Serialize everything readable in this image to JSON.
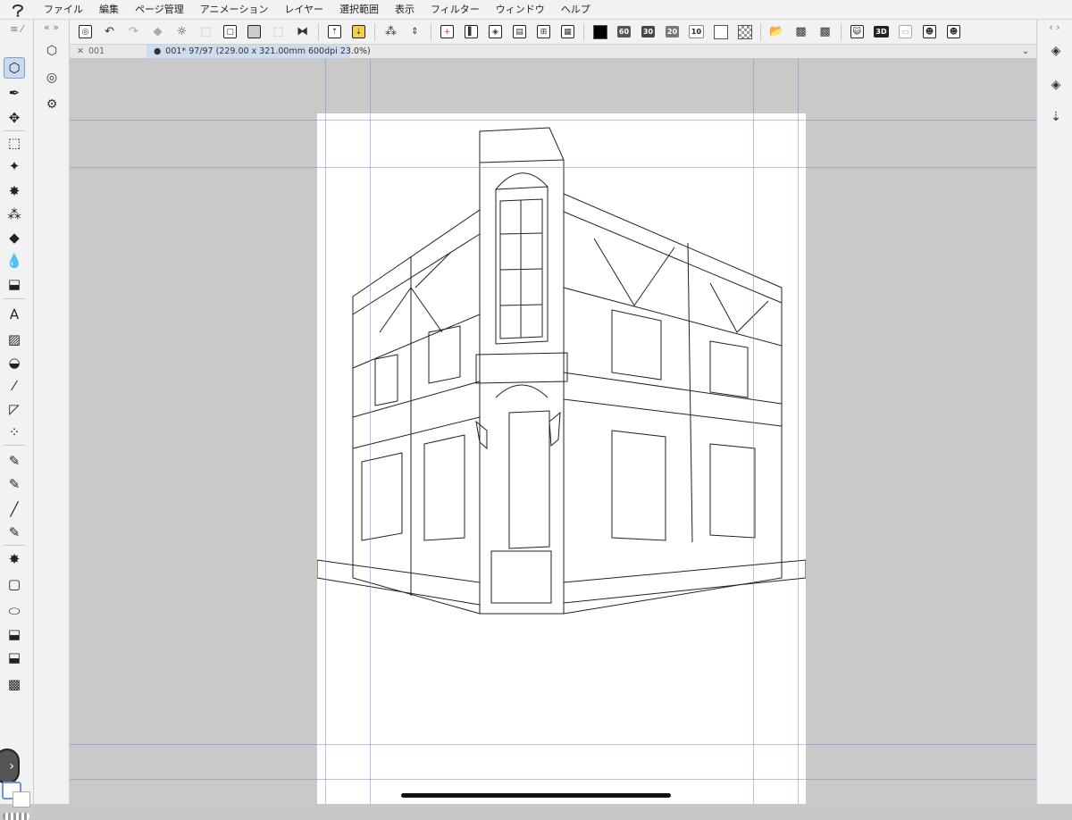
{
  "menu": {
    "items": [
      "ファイル",
      "編集",
      "ページ管理",
      "アニメーション",
      "レイヤー",
      "選択範囲",
      "表示",
      "フィルター",
      "ウィンドウ",
      "ヘルプ"
    ]
  },
  "command_bar": {
    "icons": [
      "clip-studio-icon",
      "undo-icon",
      "redo-icon",
      "erase-icon",
      "deselect-icon",
      "invert-selection-icon",
      "crop-icon",
      "fill-selection-icon",
      "clear-selection-icon",
      "transform-icon",
      "flip-horizontal-icon",
      "export-icon",
      "import-icon",
      "snap-icon",
      "stepper-icon",
      "new-layer-icon",
      "raster-layer-icon",
      "vector-layer-icon",
      "folder-layer-icon",
      "merge-layer-icon",
      "layer-mask-icon"
    ],
    "color_badges": [
      "60",
      "30",
      "20",
      "10"
    ],
    "colors": {
      "black": "#000000",
      "white": "#ffffff"
    }
  },
  "tabs": {
    "closed_tab": "001",
    "active_tab": "001* 97/97 (229.00 x 321.00mm 600dpi 23.0%)"
  },
  "toolbar": {
    "tools": [
      "operation-icon",
      "pen-icon",
      "move-icon",
      "selection-icon",
      "magic-wand-icon",
      "sparkle-icon",
      "pattern-icon",
      "eraser-icon",
      "blend-icon",
      "stamp-icon",
      "text-icon",
      "gradient-icon",
      "fill-icon",
      "brush-icon",
      "ruler-icon",
      "frame-icon",
      "pen2-icon",
      "pencil-icon",
      "line-icon",
      "marker-icon",
      "burst-icon",
      "rectangle-icon",
      "ellipse-icon",
      "figure-icon",
      "figure2-icon",
      "tone-icon"
    ]
  },
  "sub_tools": [
    "sub-tool-1-icon",
    "sub-tool-2-icon",
    "sub-tool-3-icon"
  ],
  "right_panel": [
    "layer-icon",
    "layer-property-icon",
    "import-layer-icon"
  ],
  "accent_color": "#7f9fd0"
}
